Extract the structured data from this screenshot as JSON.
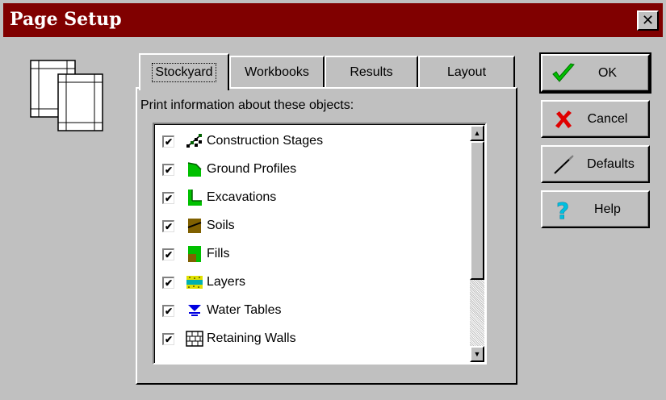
{
  "window": {
    "title": "Page Setup",
    "close_glyph": "✕"
  },
  "tabs": [
    {
      "label": "Stockyard",
      "active": true
    },
    {
      "label": "Workbooks",
      "active": false
    },
    {
      "label": "Results",
      "active": false
    },
    {
      "label": "Layout",
      "active": false
    }
  ],
  "panel": {
    "label": "Print information about these objects:",
    "items": [
      {
        "label": "Construction Stages",
        "checked": true,
        "icon": "construction-stages-icon"
      },
      {
        "label": "Ground Profiles",
        "checked": true,
        "icon": "ground-profiles-icon"
      },
      {
        "label": "Excavations",
        "checked": true,
        "icon": "excavations-icon"
      },
      {
        "label": "Soils",
        "checked": true,
        "icon": "soils-icon"
      },
      {
        "label": "Fills",
        "checked": true,
        "icon": "fills-icon"
      },
      {
        "label": "Layers",
        "checked": true,
        "icon": "layers-icon"
      },
      {
        "label": "Water Tables",
        "checked": true,
        "icon": "water-tables-icon"
      },
      {
        "label": "Retaining Walls",
        "checked": true,
        "icon": "retaining-walls-icon"
      }
    ]
  },
  "buttons": {
    "ok": "OK",
    "cancel": "Cancel",
    "defaults": "Defaults",
    "help": "Help"
  },
  "colors": {
    "titlebar": "#800000",
    "face": "#c0c0c0",
    "ok_check": "#00c000",
    "cancel_x": "#e00000",
    "help_q": "#00c0e0"
  }
}
